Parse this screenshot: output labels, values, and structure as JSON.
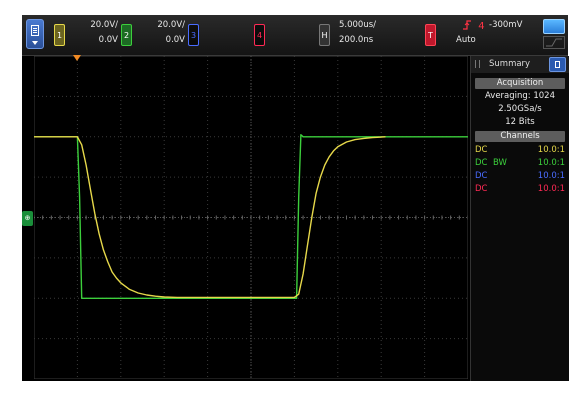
{
  "topbar": {
    "ch1": {
      "number": "1",
      "scale": "20.0V/",
      "offset": "0.0V",
      "color": "#e6d84a"
    },
    "ch2": {
      "number": "2",
      "scale": "20.0V/",
      "offset": "0.0V",
      "color": "#3ccf3c"
    },
    "ch3": {
      "number": "3",
      "color": "#4a6cff"
    },
    "ch4": {
      "number": "4",
      "color": "#ff2a55"
    },
    "horizontal": {
      "label": "H",
      "time_div": "5.000us/",
      "delay": "200.0ns"
    },
    "trigger": {
      "label": "T",
      "slope_icon": "rising-edge-icon",
      "source": "4",
      "level": "-300mV",
      "mode": "Auto"
    }
  },
  "panel": {
    "title": "Summary",
    "acquisition": {
      "header": "Acquisition",
      "averaging": "Averaging: 1024",
      "sample_rate": "2.50GSa/s",
      "bits": "12 Bits"
    },
    "channels": {
      "header": "Channels",
      "rows": [
        {
          "coupling": "DC",
          "bw": "",
          "probe": "10.0:1",
          "color": "#e6d84a"
        },
        {
          "coupling": "DC",
          "bw": "BW",
          "probe": "10.0:1",
          "color": "#3ccf3c"
        },
        {
          "coupling": "DC",
          "bw": "",
          "probe": "10.0:1",
          "color": "#4a6cff"
        },
        {
          "coupling": "DC",
          "bw": "",
          "probe": "10.0:1",
          "color": "#ff2a55"
        }
      ]
    }
  },
  "chart_data": {
    "type": "line",
    "title": "",
    "xlabel": "",
    "ylabel": "",
    "x_divisions": 10,
    "y_divisions": 8,
    "grid": true,
    "series": [
      {
        "color": "#3ccf3c",
        "x": [
          0,
          1.0,
          1.05,
          1.1,
          6.05,
          6.1,
          6.15,
          6.2,
          10
        ],
        "y": [
          2.0,
          2.0,
          0.5,
          -2.0,
          -2.0,
          0.5,
          2.05,
          2.0,
          2.0
        ]
      },
      {
        "color": "#e6d84a",
        "x": [
          0,
          1.0,
          1.1,
          1.2,
          1.3,
          1.4,
          1.5,
          1.6,
          1.7,
          1.8,
          1.9,
          2.0,
          2.2,
          2.4,
          2.6,
          2.8,
          3.0,
          3.3,
          6.0,
          6.1,
          6.2,
          6.3,
          6.4,
          6.5,
          6.6,
          6.7,
          6.8,
          6.9,
          7.0,
          7.2,
          7.4,
          7.6,
          7.8,
          8.1
        ],
        "y": [
          2.0,
          2.0,
          1.8,
          1.3,
          0.7,
          0.1,
          -0.4,
          -0.8,
          -1.1,
          -1.35,
          -1.5,
          -1.62,
          -1.78,
          -1.87,
          -1.92,
          -1.95,
          -1.97,
          -1.98,
          -1.98,
          -1.9,
          -1.4,
          -0.7,
          0.0,
          0.6,
          1.0,
          1.3,
          1.5,
          1.65,
          1.75,
          1.87,
          1.93,
          1.96,
          1.98,
          2.0
        ]
      }
    ]
  }
}
